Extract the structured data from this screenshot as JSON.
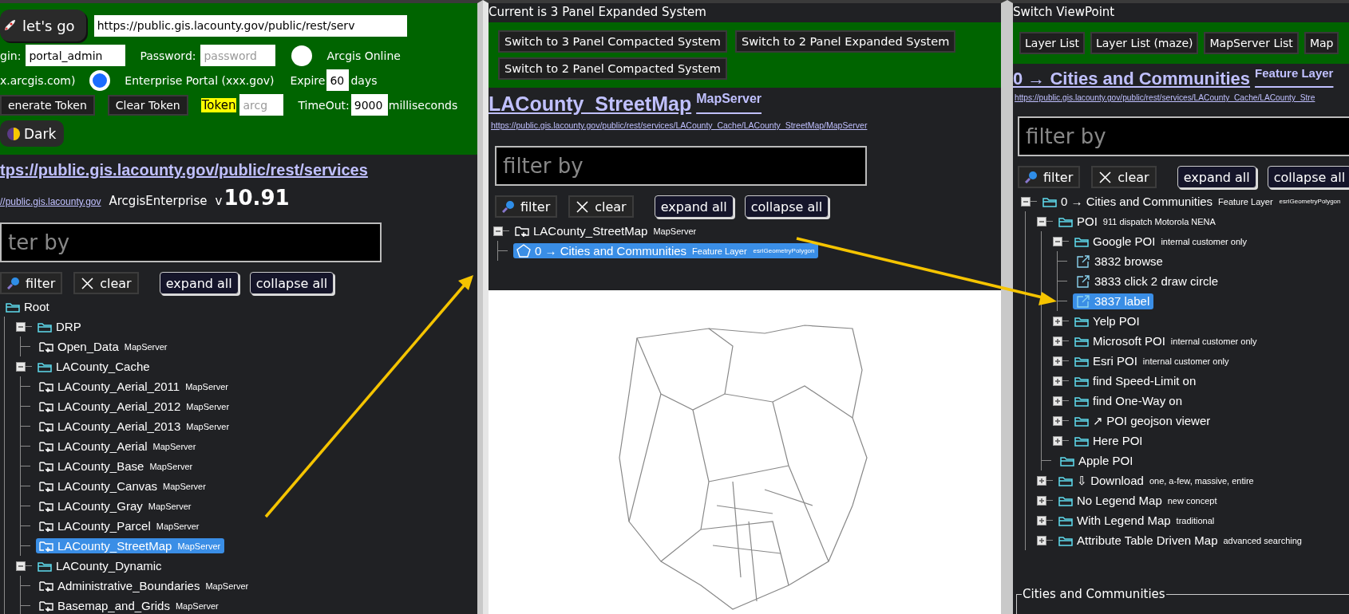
{
  "left": {
    "lets_go": "let's go",
    "url": "https://public.gis.lacounty.gov/public/rest/serv",
    "login": {
      "label": "gin:",
      "value": "portal_admin"
    },
    "password": {
      "label": "Password:",
      "placeholder": "password"
    },
    "portal_options": [
      {
        "label": "Arcgis Online",
        "note": "x.arcgis.com)",
        "selected": false
      },
      {
        "label": "Enterprise Portal (xxx.gov)",
        "selected": true
      }
    ],
    "expire": {
      "label": "Expire",
      "value": "60",
      "unit": "days"
    },
    "generate_token": "enerate Token",
    "clear_token": "Clear Token",
    "token": {
      "label": "Token",
      "placeholder": "arcg"
    },
    "timeout": {
      "label": "TimeOut:",
      "value": "9000",
      "unit": "milliseconds"
    },
    "theme": "Dark",
    "services_url": "tps://public.gis.lacounty.gov/public/rest/services",
    "site_url": "//public.gis.lacounty.gov",
    "server_type": "ArcgisEnterprise",
    "version_prefix": "v",
    "version": "10.91",
    "filter": {
      "placeholder": "ter by",
      "buttons": [
        {
          "kind": "filter",
          "label": "filter"
        },
        {
          "kind": "clear",
          "label": "clear"
        },
        {
          "kind": "expand",
          "label": "expand all"
        },
        {
          "kind": "collapse",
          "label": "collapse all"
        }
      ]
    },
    "tree": [
      {
        "label": "Root",
        "kind": "folder",
        "selected": false,
        "children": [
          {
            "label": "DRP",
            "kind": "folder",
            "expanded": true,
            "selected": false,
            "children": [
              {
                "label": "Open_Data",
                "badge": "MapServer",
                "kind": "service",
                "selected": false
              }
            ]
          },
          {
            "label": "LACounty_Cache",
            "kind": "folder",
            "expanded": true,
            "selected": false,
            "children": [
              {
                "label": "LACounty_Aerial_2011",
                "badge": "MapServer",
                "kind": "service",
                "selected": false
              },
              {
                "label": "LACounty_Aerial_2012",
                "badge": "MapServer",
                "kind": "service",
                "selected": false
              },
              {
                "label": "LACounty_Aerial_2013",
                "badge": "MapServer",
                "kind": "service",
                "selected": false
              },
              {
                "label": "LACounty_Aerial",
                "badge": "MapServer",
                "kind": "service",
                "selected": false
              },
              {
                "label": "LACounty_Base",
                "badge": "MapServer",
                "kind": "service",
                "selected": false
              },
              {
                "label": "LACounty_Canvas",
                "badge": "MapServer",
                "kind": "service",
                "selected": false
              },
              {
                "label": "LACounty_Gray",
                "badge": "MapServer",
                "kind": "service",
                "selected": false
              },
              {
                "label": "LACounty_Parcel",
                "badge": "MapServer",
                "kind": "service",
                "selected": false
              },
              {
                "label": "LACounty_StreetMap",
                "badge": "MapServer",
                "kind": "service",
                "selected": true
              }
            ]
          },
          {
            "label": "LACounty_Dynamic",
            "kind": "folder",
            "expanded": true,
            "selected": false,
            "children": [
              {
                "label": "Administrative_Boundaries",
                "badge": "MapServer",
                "kind": "service",
                "selected": false
              },
              {
                "label": "Basemap_and_Grids",
                "badge": "MapServer",
                "kind": "service",
                "selected": false
              }
            ]
          }
        ]
      }
    ]
  },
  "mid": {
    "title": "Current is 3 Panel Expanded System",
    "switch_buttons": [
      "Switch to 3 Panel Compacted System",
      "Switch to 2 Panel Expanded System",
      "Switch to 2 Panel Compacted System"
    ],
    "heading": "LACounty_StreetMap",
    "heading_badge": "MapServer",
    "url": "https://public.gis.lacounty.gov/public/rest/services/LACounty_Cache/LACounty_StreetMap/MapServer",
    "filter": {
      "placeholder": "filter by",
      "buttons": [
        {
          "kind": "filter",
          "label": "filter"
        },
        {
          "kind": "clear",
          "label": "clear"
        },
        {
          "kind": "expand",
          "label": "expand all"
        },
        {
          "kind": "collapse",
          "label": "collapse all"
        }
      ]
    },
    "tree": [
      {
        "label": "LACounty_StreetMap",
        "badge": "MapServer",
        "kind": "service",
        "expanded": true,
        "selected": false,
        "children": [
          {
            "label": "0 → Cities and Communities",
            "badge": "Feature Layer",
            "geometry": "esriGeometryPolygon",
            "kind": "polygon",
            "selected": true
          }
        ]
      }
    ]
  },
  "right": {
    "title": "Switch ViewPoint",
    "view_buttons": [
      "Layer List",
      "Layer List (maze)",
      "MapServer List",
      "Map"
    ],
    "heading": "0 → Cities and Communities",
    "heading_badge": "Feature Layer",
    "url": "https://public.gis.lacounty.gov/public/rest/services/LACounty_Cache/LACounty_Stre",
    "filter": {
      "placeholder": "filter by",
      "buttons": [
        {
          "kind": "filter",
          "label": "filter"
        },
        {
          "kind": "clear",
          "label": "clear"
        },
        {
          "kind": "expand",
          "label": "expand all"
        },
        {
          "kind": "collapse",
          "label": "collapse all"
        }
      ]
    },
    "tree": [
      {
        "label": "0 → Cities and Communities",
        "badge": "Feature Layer",
        "geometry": "esriGeometryPolygon",
        "kind": "folder",
        "expanded": true,
        "selected": false,
        "children": [
          {
            "label": "POI",
            "badge": "911 dispatch Motorola NENA",
            "kind": "folder",
            "expanded": true,
            "selected": false,
            "children": [
              {
                "label": "Google POI",
                "badge": "internal customer only",
                "kind": "folder",
                "expanded": true,
                "selected": false,
                "children": [
                  {
                    "label": "3832 browse",
                    "kind": "link",
                    "selected": false
                  },
                  {
                    "label": "3833 click 2 draw circle",
                    "kind": "link",
                    "selected": false
                  },
                  {
                    "label": "3837 label",
                    "kind": "link",
                    "selected": true
                  }
                ]
              },
              {
                "label": "Yelp POI",
                "kind": "folder",
                "expanded": false,
                "selected": false
              },
              {
                "label": "Microsoft POI",
                "badge": "internal customer only",
                "kind": "folder",
                "expanded": false,
                "selected": false
              },
              {
                "label": "Esri POI",
                "badge": "internal customer only",
                "kind": "folder",
                "expanded": false,
                "selected": false
              },
              {
                "label": "find Speed-Limit on",
                "kind": "folder",
                "expanded": false,
                "selected": false
              },
              {
                "label": "find One-Way on",
                "kind": "folder",
                "expanded": false,
                "selected": false
              },
              {
                "label": "↗ POI geojson viewer",
                "kind": "folder",
                "expanded": false,
                "selected": false
              },
              {
                "label": "Here POI",
                "kind": "folder",
                "expanded": false,
                "selected": false
              },
              {
                "label": "Apple POI",
                "kind": "folder",
                "selected": false
              }
            ]
          },
          {
            "label": "⇩ Download",
            "badge": "one, a-few, massive, entire",
            "kind": "folder",
            "expanded": false,
            "selected": false
          },
          {
            "label": "No Legend Map",
            "badge": "new concept",
            "kind": "folder",
            "expanded": false,
            "selected": false
          },
          {
            "label": "With Legend Map",
            "badge": "traditional",
            "kind": "folder",
            "expanded": false,
            "selected": false
          },
          {
            "label": "Attribute Table Driven Map",
            "badge": "advanced searching",
            "kind": "folder",
            "expanded": false,
            "selected": false
          }
        ]
      }
    ],
    "fieldset_legend": "Cities and Communities"
  }
}
